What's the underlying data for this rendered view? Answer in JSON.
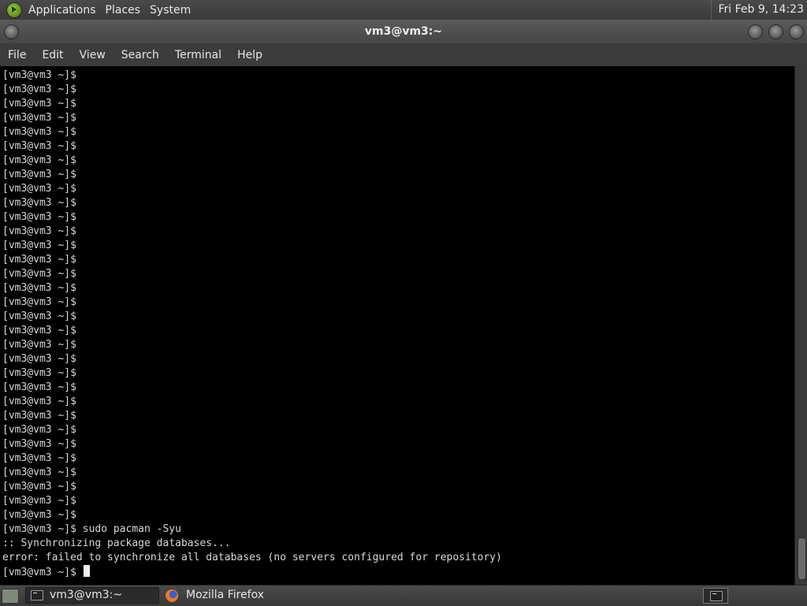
{
  "top_panel": {
    "menus": [
      "Applications",
      "Places",
      "System"
    ],
    "clock": "Fri Feb  9, 14:23"
  },
  "window": {
    "title": "vm3@vm3:~"
  },
  "menubar": {
    "items": [
      "File",
      "Edit",
      "View",
      "Search",
      "Terminal",
      "Help"
    ]
  },
  "terminal": {
    "prompt": "[vm3@vm3 ~]$",
    "lines": [
      "[vm3@vm3 ~]$",
      "[vm3@vm3 ~]$",
      "[vm3@vm3 ~]$",
      "[vm3@vm3 ~]$",
      "[vm3@vm3 ~]$",
      "[vm3@vm3 ~]$",
      "[vm3@vm3 ~]$",
      "[vm3@vm3 ~]$",
      "[vm3@vm3 ~]$",
      "[vm3@vm3 ~]$",
      "[vm3@vm3 ~]$",
      "[vm3@vm3 ~]$",
      "[vm3@vm3 ~]$",
      "[vm3@vm3 ~]$",
      "[vm3@vm3 ~]$",
      "[vm3@vm3 ~]$",
      "[vm3@vm3 ~]$",
      "[vm3@vm3 ~]$",
      "[vm3@vm3 ~]$",
      "[vm3@vm3 ~]$",
      "[vm3@vm3 ~]$",
      "[vm3@vm3 ~]$",
      "[vm3@vm3 ~]$",
      "[vm3@vm3 ~]$",
      "[vm3@vm3 ~]$",
      "[vm3@vm3 ~]$",
      "[vm3@vm3 ~]$",
      "[vm3@vm3 ~]$",
      "[vm3@vm3 ~]$",
      "[vm3@vm3 ~]$",
      "[vm3@vm3 ~]$",
      "[vm3@vm3 ~]$",
      "[vm3@vm3 ~]$ sudo pacman -Syu",
      ":: Synchronizing package databases...",
      "error: failed to synchronize all databases (no servers configured for repository)"
    ],
    "current_line": "[vm3@vm3 ~]$ "
  },
  "taskbar": {
    "tasks": [
      {
        "label": "vm3@vm3:~",
        "icon": "terminal-icon",
        "active": true
      },
      {
        "label": "Mozilla Firefox",
        "icon": "firefox-icon",
        "active": false
      }
    ]
  }
}
